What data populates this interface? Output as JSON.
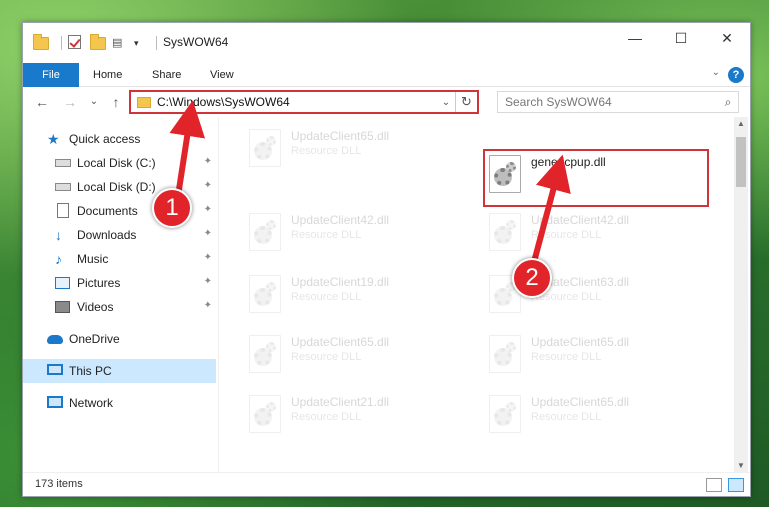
{
  "window": {
    "title": "SysWOW64",
    "minimize": "—",
    "maximize": "☐",
    "close": "✕"
  },
  "ribbon": {
    "tabs": [
      "File",
      "Home",
      "Share",
      "View"
    ],
    "help": "?",
    "collapse": "⌄"
  },
  "nav": {
    "back": "←",
    "forward": "→",
    "recent": "⌄",
    "up": "↑",
    "address": "C:\\Windows\\SysWOW64",
    "address_dropdown": "⌄",
    "refresh": "↻",
    "search_placeholder": "Search SysWOW64",
    "search_glyph": "⌕"
  },
  "sidebar": {
    "items": [
      {
        "label": "Quick access",
        "icon": "star-icon"
      },
      {
        "label": "Local Disk (C:)",
        "icon": "disk-icon",
        "pinned": true
      },
      {
        "label": "Local Disk (D:)",
        "icon": "disk-icon",
        "pinned": true
      },
      {
        "label": "Documents",
        "icon": "document-icon",
        "pinned": true
      },
      {
        "label": "Downloads",
        "icon": "download-icon",
        "pinned": true
      },
      {
        "label": "Music",
        "icon": "music-icon",
        "pinned": true
      },
      {
        "label": "Pictures",
        "icon": "pictures-icon",
        "pinned": true
      },
      {
        "label": "Videos",
        "icon": "videos-icon",
        "pinned": true
      },
      {
        "label": "OneDrive",
        "icon": "cloud-icon"
      },
      {
        "label": "This PC",
        "icon": "computer-icon",
        "selected": true
      },
      {
        "label": "Network",
        "icon": "network-icon"
      }
    ],
    "pin_glyph": "📌"
  },
  "files": {
    "highlighted": {
      "name": "genericpup.dll",
      "type": ""
    },
    "left_column": [
      {
        "name": "UpdateClient65.dll",
        "type": "Resource DLL"
      },
      {
        "name": "UpdateClient42.dll",
        "type": "Resource DLL"
      },
      {
        "name": "UpdateClient19.dll",
        "type": "Resource DLL"
      },
      {
        "name": "UpdateClient65.dll",
        "type": "Resource DLL"
      },
      {
        "name": "UpdateClient21.dll",
        "type": "Resource DLL"
      }
    ],
    "right_column": [
      {
        "name": "UpdateClient42.dll",
        "type": "Resource DLL"
      },
      {
        "name": "UpdateClient63.dll",
        "type": "Resource DLL"
      },
      {
        "name": "UpdateClient65.dll",
        "type": "Resource DLL"
      },
      {
        "name": "UpdateClient65.dll",
        "type": "Resource DLL"
      }
    ]
  },
  "status": {
    "items_count": "173 items"
  },
  "annotations": {
    "callout_1": "1",
    "callout_2": "2"
  },
  "colors": {
    "accent": "#1979ca",
    "highlight": "#d13438",
    "selected": "#cce8ff"
  }
}
